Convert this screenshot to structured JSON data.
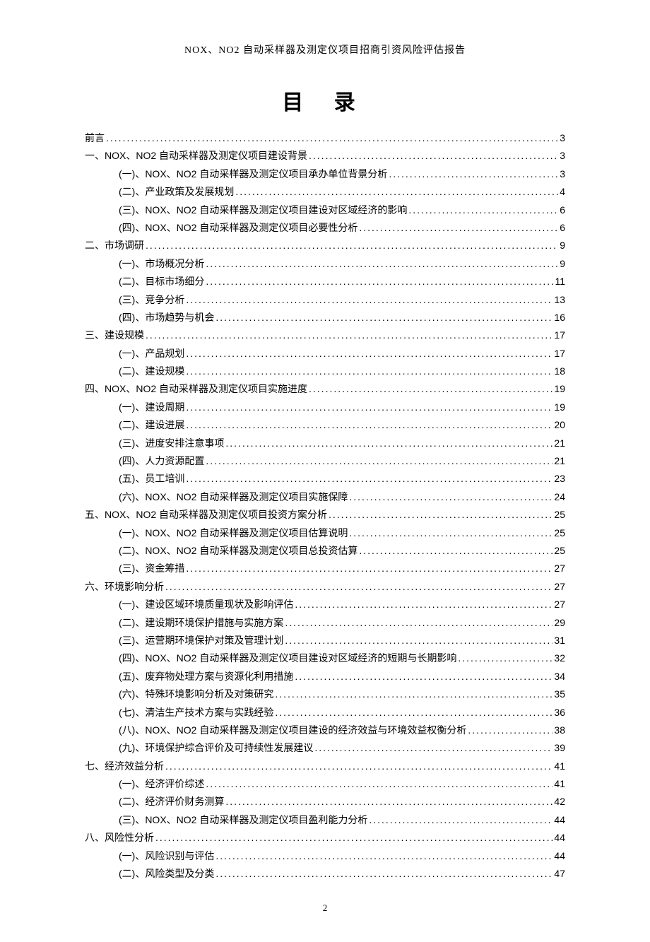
{
  "header": "NOX、NO2 自动采样器及测定仪项目招商引资风险评估报告",
  "toc_title": "目 录",
  "page_number": "2",
  "toc": [
    {
      "level": 1,
      "label": "前言",
      "page": "3"
    },
    {
      "level": 1,
      "label": "一、NOX、NO2 自动采样器及测定仪项目建设背景",
      "page": "3"
    },
    {
      "level": 2,
      "label": "(一)、NOX、NO2 自动采样器及测定仪项目承办单位背景分析",
      "page": "3"
    },
    {
      "level": 2,
      "label": "(二)、产业政策及发展规划",
      "page": "4"
    },
    {
      "level": 2,
      "label": "(三)、NOX、NO2 自动采样器及测定仪项目建设对区域经济的影响",
      "page": "6"
    },
    {
      "level": 2,
      "label": "(四)、NOX、NO2 自动采样器及测定仪项目必要性分析",
      "page": "6"
    },
    {
      "level": 1,
      "label": "二、市场调研",
      "page": "9"
    },
    {
      "level": 2,
      "label": "(一)、市场概况分析",
      "page": "9"
    },
    {
      "level": 2,
      "label": "(二)、目标市场细分",
      "page": "11"
    },
    {
      "level": 2,
      "label": "(三)、竞争分析",
      "page": "13"
    },
    {
      "level": 2,
      "label": "(四)、市场趋势与机会",
      "page": "16"
    },
    {
      "level": 1,
      "label": "三、建设规模",
      "page": "17"
    },
    {
      "level": 2,
      "label": "(一)、产品规划",
      "page": "17"
    },
    {
      "level": 2,
      "label": "(二)、建设规模",
      "page": "18"
    },
    {
      "level": 1,
      "label": "四、NOX、NO2 自动采样器及测定仪项目实施进度",
      "page": "19"
    },
    {
      "level": 2,
      "label": "(一)、建设周期",
      "page": "19"
    },
    {
      "level": 2,
      "label": "(二)、建设进展",
      "page": "20"
    },
    {
      "level": 2,
      "label": "(三)、进度安排注意事项",
      "page": "21"
    },
    {
      "level": 2,
      "label": "(四)、人力资源配置",
      "page": "21"
    },
    {
      "level": 2,
      "label": "(五)、员工培训",
      "page": "23"
    },
    {
      "level": 2,
      "label": "(六)、NOX、NO2 自动采样器及测定仪项目实施保障",
      "page": "24"
    },
    {
      "level": 1,
      "label": "五、NOX、NO2 自动采样器及测定仪项目投资方案分析",
      "page": "25"
    },
    {
      "level": 2,
      "label": "(一)、NOX、NO2 自动采样器及测定仪项目估算说明",
      "page": "25"
    },
    {
      "level": 2,
      "label": "(二)、NOX、NO2 自动采样器及测定仪项目总投资估算",
      "page": "25"
    },
    {
      "level": 2,
      "label": "(三)、资金筹措",
      "page": "27"
    },
    {
      "level": 1,
      "label": "六、环境影响分析",
      "page": "27"
    },
    {
      "level": 2,
      "label": "(一)、建设区域环境质量现状及影响评估",
      "page": "27"
    },
    {
      "level": 2,
      "label": "(二)、建设期环境保护措施与实施方案",
      "page": "29"
    },
    {
      "level": 2,
      "label": "(三)、运营期环境保护对策及管理计划",
      "page": "31"
    },
    {
      "level": 2,
      "label": "(四)、NOX、NO2 自动采样器及测定仪项目建设对区域经济的短期与长期影响",
      "page": "32"
    },
    {
      "level": 2,
      "label": "(五)、废弃物处理方案与资源化利用措施",
      "page": "34"
    },
    {
      "level": 2,
      "label": "(六)、特殊环境影响分析及对策研究",
      "page": "35"
    },
    {
      "level": 2,
      "label": "(七)、清洁生产技术方案与实践经验",
      "page": "36"
    },
    {
      "level": 2,
      "label": "(八)、NOX、NO2 自动采样器及测定仪项目建设的经济效益与环境效益权衡分析",
      "page": "38"
    },
    {
      "level": 2,
      "label": "(九)、环境保护综合评价及可持续性发展建议",
      "page": "39"
    },
    {
      "level": 1,
      "label": "七、经济效益分析",
      "page": "41"
    },
    {
      "level": 2,
      "label": "(一)、经济评价综述",
      "page": "41"
    },
    {
      "level": 2,
      "label": "(二)、经济评价财务测算",
      "page": "42"
    },
    {
      "level": 2,
      "label": "(三)、NOX、NO2 自动采样器及测定仪项目盈利能力分析",
      "page": "44"
    },
    {
      "level": 1,
      "label": "八、风险性分析",
      "page": "44"
    },
    {
      "level": 2,
      "label": "(一)、风险识别与评估",
      "page": "44"
    },
    {
      "level": 2,
      "label": "(二)、风险类型及分类",
      "page": "47"
    }
  ]
}
